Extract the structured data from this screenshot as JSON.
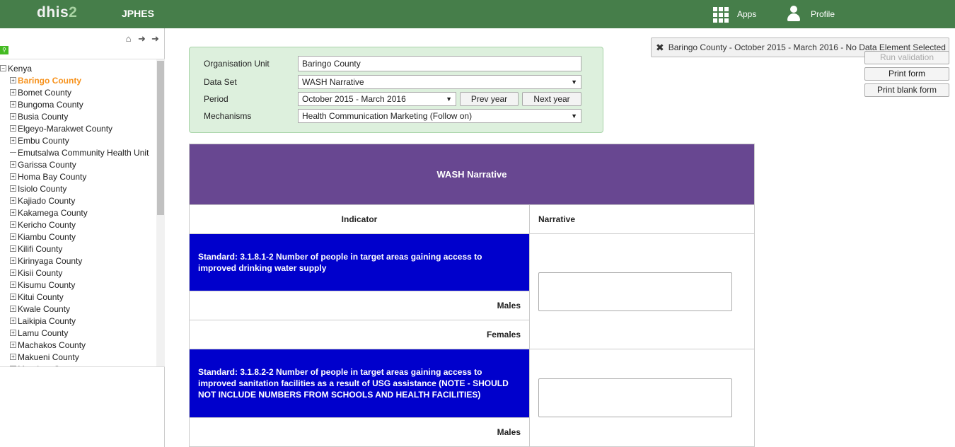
{
  "header": {
    "logo_main": "dhis",
    "logo_num": "2",
    "app_title": "JPHES",
    "apps_label": "Apps",
    "profile_label": "Profile"
  },
  "sidebar": {
    "nav_icons": [
      "home-icon",
      "back-arrow-icon",
      "forward-arrow-icon"
    ],
    "root": "Kenya",
    "items": [
      {
        "label": "Baringo County",
        "selected": true,
        "leaf": false
      },
      {
        "label": "Bomet County",
        "leaf": false
      },
      {
        "label": "Bungoma County",
        "leaf": false
      },
      {
        "label": "Busia County",
        "leaf": false
      },
      {
        "label": "Elgeyo-Marakwet County",
        "leaf": false
      },
      {
        "label": "Embu County",
        "leaf": false
      },
      {
        "label": "Emutsalwa Community Health Unit",
        "leaf": true
      },
      {
        "label": "Garissa County",
        "leaf": false
      },
      {
        "label": "Homa Bay County",
        "leaf": false
      },
      {
        "label": "Isiolo County",
        "leaf": false
      },
      {
        "label": "Kajiado County",
        "leaf": false
      },
      {
        "label": "Kakamega County",
        "leaf": false
      },
      {
        "label": "Kericho County",
        "leaf": false
      },
      {
        "label": "Kiambu County",
        "leaf": false
      },
      {
        "label": "Kilifi County",
        "leaf": false
      },
      {
        "label": "Kirinyaga County",
        "leaf": false
      },
      {
        "label": "Kisii County",
        "leaf": false
      },
      {
        "label": "Kisumu County",
        "leaf": false
      },
      {
        "label": "Kitui County",
        "leaf": false
      },
      {
        "label": "Kwale County",
        "leaf": false
      },
      {
        "label": "Laikipia County",
        "leaf": false
      },
      {
        "label": "Lamu County",
        "leaf": false
      },
      {
        "label": "Machakos County",
        "leaf": false
      },
      {
        "label": "Makueni County",
        "leaf": false
      },
      {
        "label": "Mandera County",
        "leaf": false
      }
    ]
  },
  "form": {
    "org_unit_label": "Organisation Unit",
    "org_unit_value": "Baringo County",
    "dataset_label": "Data Set",
    "dataset_value": "WASH Narrative",
    "period_label": "Period",
    "period_value": "October 2015 - March 2016",
    "prev_year": "Prev year",
    "next_year": "Next year",
    "mechanisms_label": "Mechanisms",
    "mechanisms_value": "Health Communication Marketing (Follow on)"
  },
  "actions": {
    "run_validation": "Run validation",
    "print_form": "Print form",
    "print_blank_form": "Print blank form"
  },
  "notice": "Baringo County - October 2015 - March 2016 - No Data Element Selected",
  "dataform": {
    "title": "WASH Narrative",
    "col_indicator": "Indicator",
    "col_narrative": "Narrative",
    "indicator1": "Standard: 3.1.8.1-2 Number of people in target areas gaining access to improved drinking water supply",
    "indicator2": "Standard: 3.1.8.2-2 Number of people in target areas gaining access to improved sanitation facilities as a result of USG assistance (NOTE - SHOULD NOT INCLUDE NUMBERS FROM SCHOOLS AND HEALTH FACILITIES)",
    "males": "Males",
    "females": "Females"
  }
}
